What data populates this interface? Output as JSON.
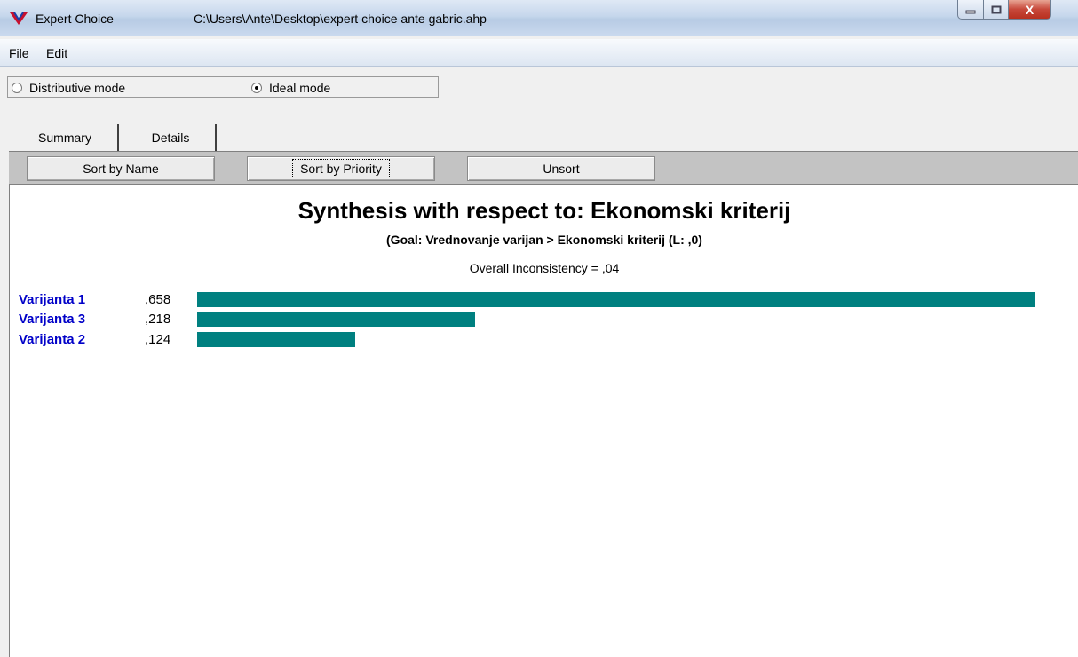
{
  "window": {
    "app_name": "Expert Choice",
    "file_path": "C:\\Users\\Ante\\Desktop\\expert choice ante gabric.ahp",
    "close_glyph": "X"
  },
  "menu": {
    "file": "File",
    "edit": "Edit"
  },
  "modes": {
    "distributive": "Distributive mode",
    "ideal": "Ideal mode",
    "selected": "ideal"
  },
  "tabs": [
    {
      "label": "Summary",
      "active": true
    },
    {
      "label": "Details",
      "active": false
    }
  ],
  "toolbar": {
    "sort_by_name": "Sort by Name",
    "sort_by_priority": "Sort by Priority",
    "unsort": "Unsort"
  },
  "synthesis": {
    "title": "Synthesis with respect to: Ekonomski kriterij",
    "goal_line": "(Goal: Vrednovanje varijan > Ekonomski kriterij (L: ,0)",
    "inconsistency_label": "Overall Inconsistency =",
    "inconsistency_value": ",04"
  },
  "chart_data": {
    "type": "bar",
    "orientation": "horizontal",
    "categories": [
      "Varijanta 1",
      "Varijanta 3",
      "Varijanta 2"
    ],
    "values": [
      0.658,
      0.218,
      0.124
    ],
    "value_labels": [
      ",658",
      ",218",
      ",124"
    ],
    "bar_color": "#008080",
    "label_color": "#0000c8"
  }
}
